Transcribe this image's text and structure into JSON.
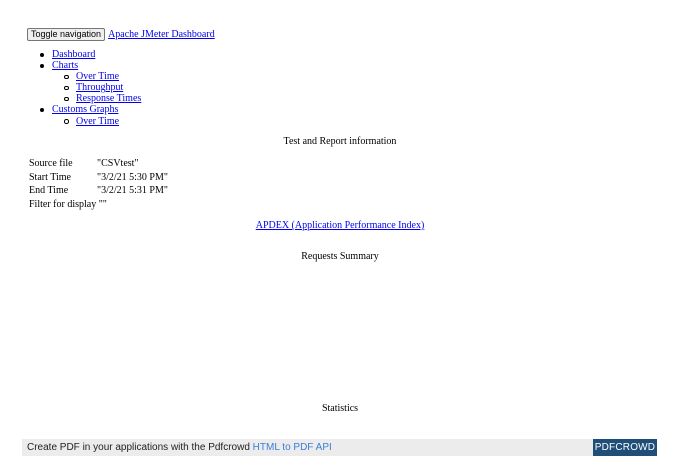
{
  "navbar": {
    "toggle_label": "Toggle navigation",
    "brand": "Apache JMeter Dashboard"
  },
  "sidebar": {
    "items": [
      {
        "label": "Dashboard",
        "children": []
      },
      {
        "label": "Charts",
        "children": [
          "Over Time",
          "Throughput",
          "Response Times"
        ]
      },
      {
        "label": "Customs Graphs",
        "children": [
          "Over Time"
        ]
      }
    ]
  },
  "report_info": {
    "title": "Test and Report information",
    "rows": [
      {
        "label": "Source file",
        "value": "\"CSVtest\""
      },
      {
        "label": "Start Time",
        "value": "\"3/2/21 5:30 PM\""
      },
      {
        "label": "End Time",
        "value": "\"3/2/21 5:31 PM\""
      },
      {
        "label": "Filter for display",
        "value": "\"\""
      }
    ]
  },
  "apdex_link": "APDEX (Application Performance Index)",
  "requests_summary_title": "Requests Summary",
  "statistics_title": "Statistics",
  "footer": {
    "text": "Create PDF in your applications with the Pdfcrowd",
    "link": "HTML to PDF API",
    "button": "PDFCROWD",
    "button_color": "#1f4e79",
    "link_color": "#3b7dd8"
  }
}
